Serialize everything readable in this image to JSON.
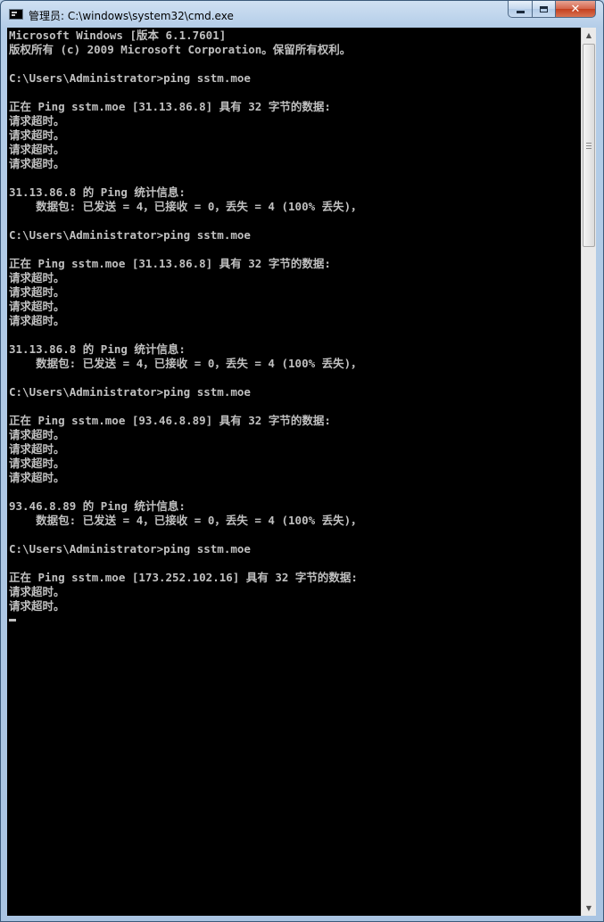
{
  "window": {
    "title": "管理员: C:\\windows\\system32\\cmd.exe",
    "close_glyph": "✕"
  },
  "scrollbar": {
    "up_glyph": "▲",
    "down_glyph": "▼"
  },
  "console": {
    "lines": [
      "Microsoft Windows [版本 6.1.7601]",
      "版权所有 (c) 2009 Microsoft Corporation。保留所有权利。",
      "",
      "C:\\Users\\Administrator>ping sstm.moe",
      "",
      "正在 Ping sstm.moe [31.13.86.8] 具有 32 字节的数据:",
      "请求超时。",
      "请求超时。",
      "请求超时。",
      "请求超时。",
      "",
      "31.13.86.8 的 Ping 统计信息:",
      "    数据包: 已发送 = 4，已接收 = 0，丢失 = 4 (100% 丢失)，",
      "",
      "C:\\Users\\Administrator>ping sstm.moe",
      "",
      "正在 Ping sstm.moe [31.13.86.8] 具有 32 字节的数据:",
      "请求超时。",
      "请求超时。",
      "请求超时。",
      "请求超时。",
      "",
      "31.13.86.8 的 Ping 统计信息:",
      "    数据包: 已发送 = 4，已接收 = 0，丢失 = 4 (100% 丢失)，",
      "",
      "C:\\Users\\Administrator>ping sstm.moe",
      "",
      "正在 Ping sstm.moe [93.46.8.89] 具有 32 字节的数据:",
      "请求超时。",
      "请求超时。",
      "请求超时。",
      "请求超时。",
      "",
      "93.46.8.89 的 Ping 统计信息:",
      "    数据包: 已发送 = 4，已接收 = 0，丢失 = 4 (100% 丢失)，",
      "",
      "C:\\Users\\Administrator>ping sstm.moe",
      "",
      "正在 Ping sstm.moe [173.252.102.16] 具有 32 字节的数据:",
      "请求超时。",
      "请求超时。",
      ""
    ]
  },
  "colors": {
    "console_bg": "#000000",
    "console_fg": "#c0c0c0",
    "titlebar": "#b4cde8",
    "close_button": "#c4401f"
  },
  "icons": {
    "app": "cmd-icon",
    "minimize": "minimize-icon",
    "maximize": "maximize-icon",
    "close": "close-icon"
  }
}
